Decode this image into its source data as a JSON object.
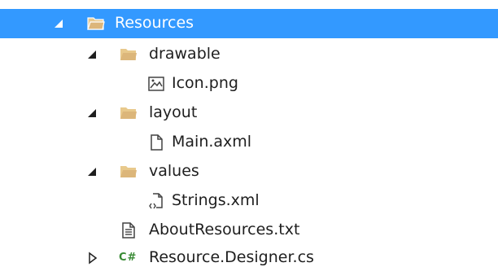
{
  "solution_explorer": {
    "items": [
      {
        "label": "Resources",
        "type": "folder",
        "expanded": true,
        "selected": true
      },
      {
        "label": "drawable",
        "type": "folder",
        "expanded": true
      },
      {
        "label": "Icon.png",
        "type": "image-file"
      },
      {
        "label": "layout",
        "type": "folder",
        "expanded": true
      },
      {
        "label": "Main.axml",
        "type": "file"
      },
      {
        "label": "values",
        "type": "folder",
        "expanded": true
      },
      {
        "label": "Strings.xml",
        "type": "xml-file"
      },
      {
        "label": "AboutResources.txt",
        "type": "text-file"
      },
      {
        "label": "Resource.Designer.cs",
        "type": "csharp-file",
        "expanded": false,
        "icon_text": "C#"
      }
    ]
  },
  "colors": {
    "selection": "#3399ff",
    "folder": "#dcb67a",
    "csharp": "#388a34",
    "text": "#1e1e1e"
  }
}
